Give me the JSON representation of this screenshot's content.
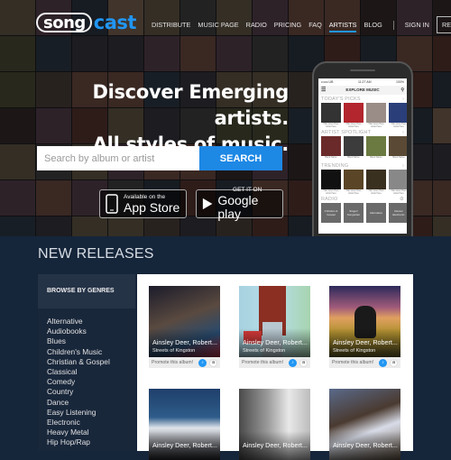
{
  "header": {
    "logo_left": "song",
    "logo_right": "cast",
    "nav": [
      "DISTRIBUTE",
      "MUSIC PAGE",
      "RADIO",
      "PRICING",
      "FAQ",
      "ARTISTS",
      "BLOG"
    ],
    "active_nav": "ARTISTS",
    "sign_in": "SIGN IN",
    "register": "REGISTER"
  },
  "hero": {
    "headline_1": "Discover Emerging artists.",
    "headline_2": "All styles of music.",
    "search_placeholder": "Search by album or artist",
    "search_button": "SEARCH",
    "app_store_small": "Available on the",
    "app_store_big": "App Store",
    "google_small": "GET IT ON",
    "google_big": "Google play"
  },
  "phone": {
    "carrier": "•••oo UB",
    "time": "11:27 AM",
    "battery": "100%",
    "title": "EXPLORE MUSIC",
    "sections": {
      "picks": "TODAY'S PICKS",
      "spotlight": "ARTIST SPOTLIGHT",
      "trending": "TRENDING",
      "radio": "RADIO"
    },
    "pick_caption": "Title Goes Here Artist Here",
    "band_caption": "Band Name",
    "radio_stations": [
      "Christian & Gospel",
      "Singer/ Songwriter",
      "Alternative",
      "Dance/ Electronic"
    ]
  },
  "new_releases": {
    "title": "NEW RELEASES",
    "browse_title": "BROWSE BY GENRES",
    "genres": [
      "Alternative",
      "Audiobooks",
      "Blues",
      "Children's Music",
      "Christian & Gospel",
      "Classical",
      "Comedy",
      "Country",
      "Dance",
      "Easy Listening",
      "Electronic",
      "Heavy Metal",
      "Hip Hop/Rap"
    ],
    "cards": [
      {
        "artist": "Ainsley Deer, Robert...",
        "album": "Streets of Kingston",
        "promo": "Promote this album!"
      },
      {
        "artist": "Ainsley Deer, Robert...",
        "album": "Streets of Kingston",
        "promo": "Promote this album!"
      },
      {
        "artist": "Ainsley Deer, Robert...",
        "album": "Streets of Kingston",
        "promo": "Promote this album!"
      },
      {
        "artist": "Ainsley Deer, Robert...",
        "album": "",
        "promo": ""
      },
      {
        "artist": "Ainsley Deer, Robert...",
        "album": "",
        "promo": ""
      },
      {
        "artist": "Ainsley Deer, Robert...",
        "album": "",
        "promo": ""
      }
    ]
  },
  "colors": {
    "accent": "#1e88e5",
    "panel": "#19273b",
    "page_bg": "#15253a"
  }
}
